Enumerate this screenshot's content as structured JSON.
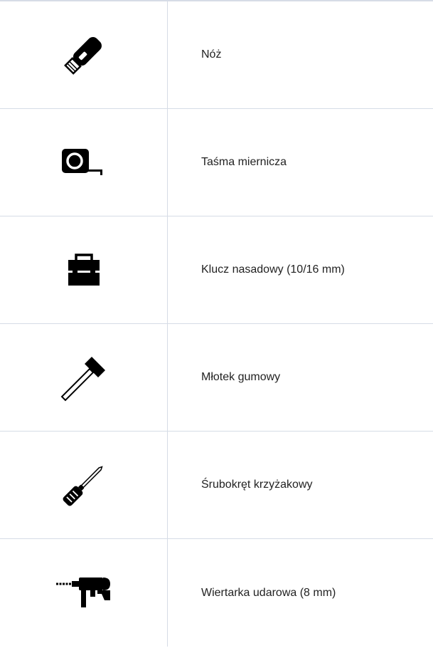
{
  "tools": [
    {
      "icon": "utility-knife-icon",
      "label": "Nóż"
    },
    {
      "icon": "tape-measure-icon",
      "label": "Taśma miernicza"
    },
    {
      "icon": "toolbox-icon",
      "label": "Klucz nasadowy (10/16 mm)"
    },
    {
      "icon": "hammer-icon",
      "label": "Młotek gumowy"
    },
    {
      "icon": "screwdriver-icon",
      "label": "Śrubokręt krzyżakowy"
    },
    {
      "icon": "hammer-drill-icon",
      "label": "Wiertarka udarowa (8 mm)"
    }
  ]
}
